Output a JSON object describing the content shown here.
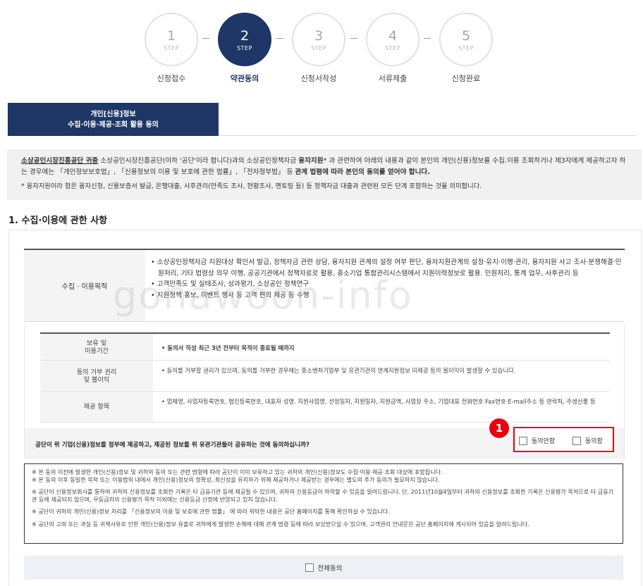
{
  "steps": [
    {
      "num": "1",
      "sub": "STEP",
      "label": "신청접수"
    },
    {
      "num": "2",
      "sub": "STEP",
      "label": "약관동의"
    },
    {
      "num": "3",
      "sub": "STEP",
      "label": "신청서작성"
    },
    {
      "num": "4",
      "sub": "STEP",
      "label": "서류제출"
    },
    {
      "num": "5",
      "sub": "STEP",
      "label": "신청완료"
    }
  ],
  "active_step": 2,
  "tab": {
    "line1": "개인[신용]정보",
    "line2": "수집·이용·제공·조회 활용 동의"
  },
  "intro": {
    "org": "소상공인시장진흥공단 귀중",
    "t1": " 소상공인시장진흥공단(이하 '공단'이라 합니다)과의 소상공인정책자금 ",
    "b1": "융자지원",
    "t2": "* 과 관련하여 아래의 내용과 같이 본인의 개인(신용)정보를 수집.이용 조회하거나 제3자에게 제공하고자 하는 경우에는 「개인정보보호법」, 「신용정보의 이용 및 보호에 관한 법률」, 「전자정부법」 등 ",
    "b2": "관계 법령에 따라 본인의 동의를 얻어야 합니다.",
    "note": "* 융자지원이라 함은 융자신청, 신용보증서 발급, 은행대출, 사후관리(만족도 조사, 현황조사, 멘토링 등) 등 정책자금 대출과 관련된 모든 단계 포함하는 것을 의미합니다."
  },
  "section_title": "1. 수집·이용에 관한 사항",
  "purpose": {
    "header": "수집 · 이용목적",
    "items": [
      "• 소상공인정책자금 지원대상 확인서 발급, 정책자금 관련 상담, 융자지원 관계의 설정 여부 판단, 융자지원관계의 설정·유지·이행·관리, 융자지원 사고 조사·분쟁해결·민원처리, 기타 법령상 의무 이행, 공공기관에서 정책자료로 활용, 중소기업 통합관리시스템에서 지원이력정보로 활용. 민원처리, 통계 업무, 사후관리 등",
      "• 고객만족도 및 실태조사, 성과평가, 소상공인 정책연구",
      "• 지원정책 홍보, 이벤트 행사 등 고객 편의 제공 등 수행"
    ]
  },
  "rows": [
    {
      "header": "보유 및\n이용기간",
      "content": "• 동의서 작성 최근 3년 전부터 목적이 종료될 때까지"
    },
    {
      "header": "동의 거부 권리\n및 불이익",
      "content": "• 동의를 거부할 권리가 있으며, 동의를 거부한 경우에는 중소벤처기업부 및 유관기관의 연계지원정보 미제공 등의 불이익이 발생할 수 있습니다."
    },
    {
      "header": "제공 항목",
      "content": "• 업체명, 사업자등록번호, 법인등록번호, 대표자 성명. 지원사업명, 선정일자, 지원일자, 지원금액, 사업장 주소, 기업대표 전화번호·Fax번호·E-mail주소 등 연락처, 주생산품 등"
    }
  ],
  "question": "공단이 위 기업(신용)정보를 정부에 제공하고, 제공된 정보를 위 유관기관들이 공유하는 것에 동의하십니까?",
  "options": {
    "disagree": "동의안함",
    "agree": "동의함"
  },
  "badge": "1",
  "notes": [
    "※ 본 동의 이전에 발생한 개인(신용)정보 및 귀하의 동의 또는 관련 법령에 따라 공단이 이미 보유하고 있는 귀하의 개인(신용)정보도 수집·이용·제공·조회 대상에 포함됩니다.\n※ 본 동의 이후 동일한 목적 또는 이용범위 내에서 개인(신용)정보의 정확성, 최신성을 유지하기 위해 제공하거나 제공받는 경우에는 별도의 추가 동의가 필요하지 않습니다.",
    "※ 공단이 신용정보회사를 통하여 귀하의 신용정보를 조회한 기록은 타 금융기관 등에 제공될 수 있으며, 귀하의 신용등급이 하락할 수 있음을 알려드립니다. 단, 2011년10월4일부터 귀하의 신용정보를 조회한 기록은 신용평가 목적으로 타 금융기관 등에 제공되지 않으며, 무등급자의 신용평가 목적 이외에는 신용등급 산정에 반영되고 있지 않습니다.",
    "※ 공단이 귀하의 개인(신용)정보 처리를 「신용정보의 이용 및 보호에 관한 법률」 에 따라 위탁한 내용은 공단 홈페이지를 통해 확인하실 수 있습니다.",
    "※ 공단의 고의 또는 과실 등 귀책사유로 인한 개인(신용)정보 유출로 귀하에게 발생한 손해에 대해 관계 법령 등에 따라 보상받으실 수 있으며, 고객권리 안내문은 공단 홈페이지에 게시되어 있음을 알려드립니다."
  ],
  "all_agree": "전체동의",
  "watermark": "gonawoon-info"
}
